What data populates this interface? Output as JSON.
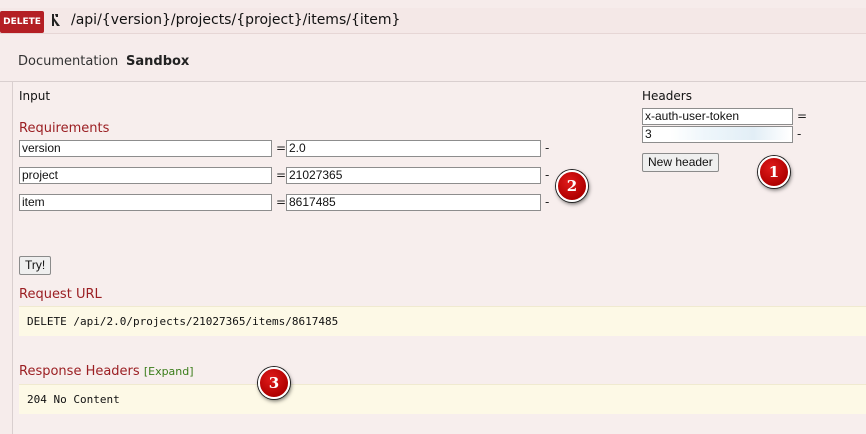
{
  "endpoint": {
    "method": "DELETE",
    "path": "/api/{version}/projects/{project}/items/{item}"
  },
  "tabs": [
    {
      "label": "Documentation"
    },
    {
      "label": "Sandbox"
    }
  ],
  "input": {
    "heading": "Input",
    "requirements_title": "Requirements",
    "params": [
      {
        "name": "version",
        "value": "2.0"
      },
      {
        "name": "project",
        "value": "21027365"
      },
      {
        "name": "item",
        "value": "8617485"
      }
    ],
    "equals": "=",
    "remove": "-",
    "try_label": "Try!"
  },
  "headers": {
    "heading": "Headers",
    "name": "x-auth-user-token",
    "value": "3",
    "equals": "=",
    "remove": "-",
    "new_header_label": "New header"
  },
  "request_url": {
    "title": "Request URL",
    "value": "DELETE /api/2.0/projects/21027365/items/8617485"
  },
  "response_headers": {
    "title": "Response Headers",
    "expand_label": "[Expand]",
    "value": "204 No Content"
  },
  "markers": [
    "1",
    "2",
    "3"
  ],
  "colors": {
    "method_badge": "#b41f24",
    "section_title": "#9b1f23",
    "code_background": "#fdf9e6",
    "expand_link": "#3a7d1a"
  }
}
